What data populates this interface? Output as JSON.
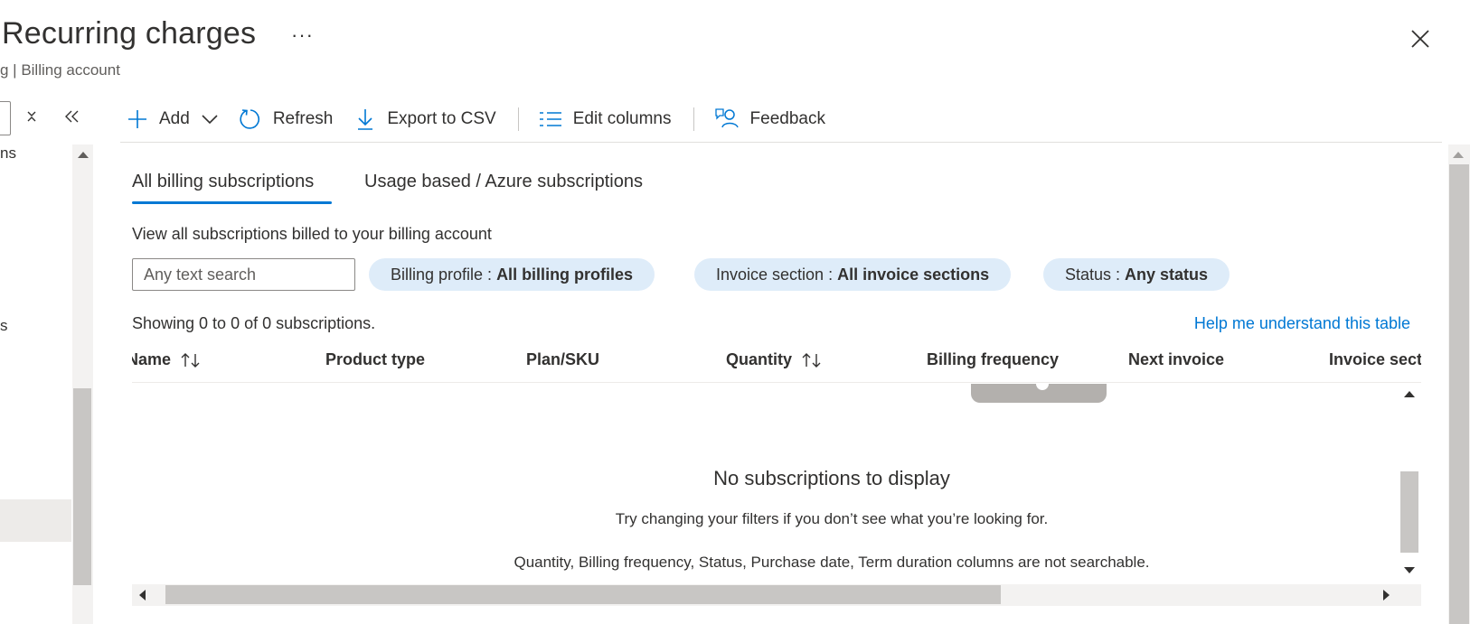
{
  "header": {
    "title": "Recurring charges",
    "more_glyph": "···",
    "breadcrumb": "g | Billing account"
  },
  "nav": {
    "item_1": "ns",
    "item_2": "s"
  },
  "toolbar": {
    "add_label": "Add",
    "refresh_label": "Refresh",
    "export_label": "Export to CSV",
    "edit_columns_label": "Edit columns",
    "feedback_label": "Feedback"
  },
  "tabs": [
    {
      "label": "All billing subscriptions"
    },
    {
      "label": "Usage based / Azure subscriptions"
    }
  ],
  "description": "View all subscriptions billed to your billing account",
  "search": {
    "placeholder": "Any text search",
    "value": ""
  },
  "filters": [
    {
      "label": "Billing profile :",
      "value": "All billing profiles"
    },
    {
      "label": "Invoice section :",
      "value": "All invoice sections"
    },
    {
      "label": "Status :",
      "value": "Any status"
    }
  ],
  "results": {
    "showing": "Showing 0 to 0 of 0 subscriptions.",
    "help_link": "Help me understand this table"
  },
  "grid": {
    "columns": [
      "Name",
      "Product type",
      "Plan/SKU",
      "Quantity",
      "Billing frequency",
      "Next invoice",
      "Invoice sect"
    ],
    "empty_title": "No subscriptions to display",
    "empty_subtitle": "Try changing your filters if you don’t see what you’re looking for.",
    "empty_note": "Quantity, Billing frequency, Status, Purchase date, Term duration columns are not searchable."
  },
  "colors": {
    "accent": "#0078d4",
    "pill_bg": "#deecf9",
    "text": "#323130"
  }
}
